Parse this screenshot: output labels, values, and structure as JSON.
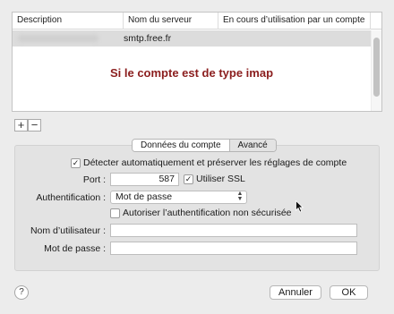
{
  "table": {
    "columns": [
      "Description",
      "Nom du serveur",
      "En cours d’utilisation par un compte"
    ],
    "rows": [
      {
        "server": "smtp.free.fr"
      }
    ],
    "overlay_note": "Si le compte est de type imap"
  },
  "list_buttons": {
    "add": "+",
    "remove": "−"
  },
  "tabs": [
    "Données du compte",
    "Avancé"
  ],
  "form": {
    "auto_detect": {
      "label": "Détecter automatiquement et préserver les réglages de compte",
      "checked": "✓"
    },
    "port": {
      "label": "Port :",
      "value": "587"
    },
    "ssl": {
      "label": "Utiliser SSL",
      "checked": "✓"
    },
    "auth": {
      "label": "Authentification :",
      "value": "Mot de passe"
    },
    "insecure": {
      "label": "Autoriser l’authentification non sécurisée",
      "checked": ""
    },
    "username": {
      "label": "Nom d’utilisateur :",
      "value": ""
    },
    "password": {
      "label": "Mot de passe :",
      "value": ""
    }
  },
  "footer": {
    "help": "?",
    "cancel": "Annuler",
    "ok": "OK"
  }
}
